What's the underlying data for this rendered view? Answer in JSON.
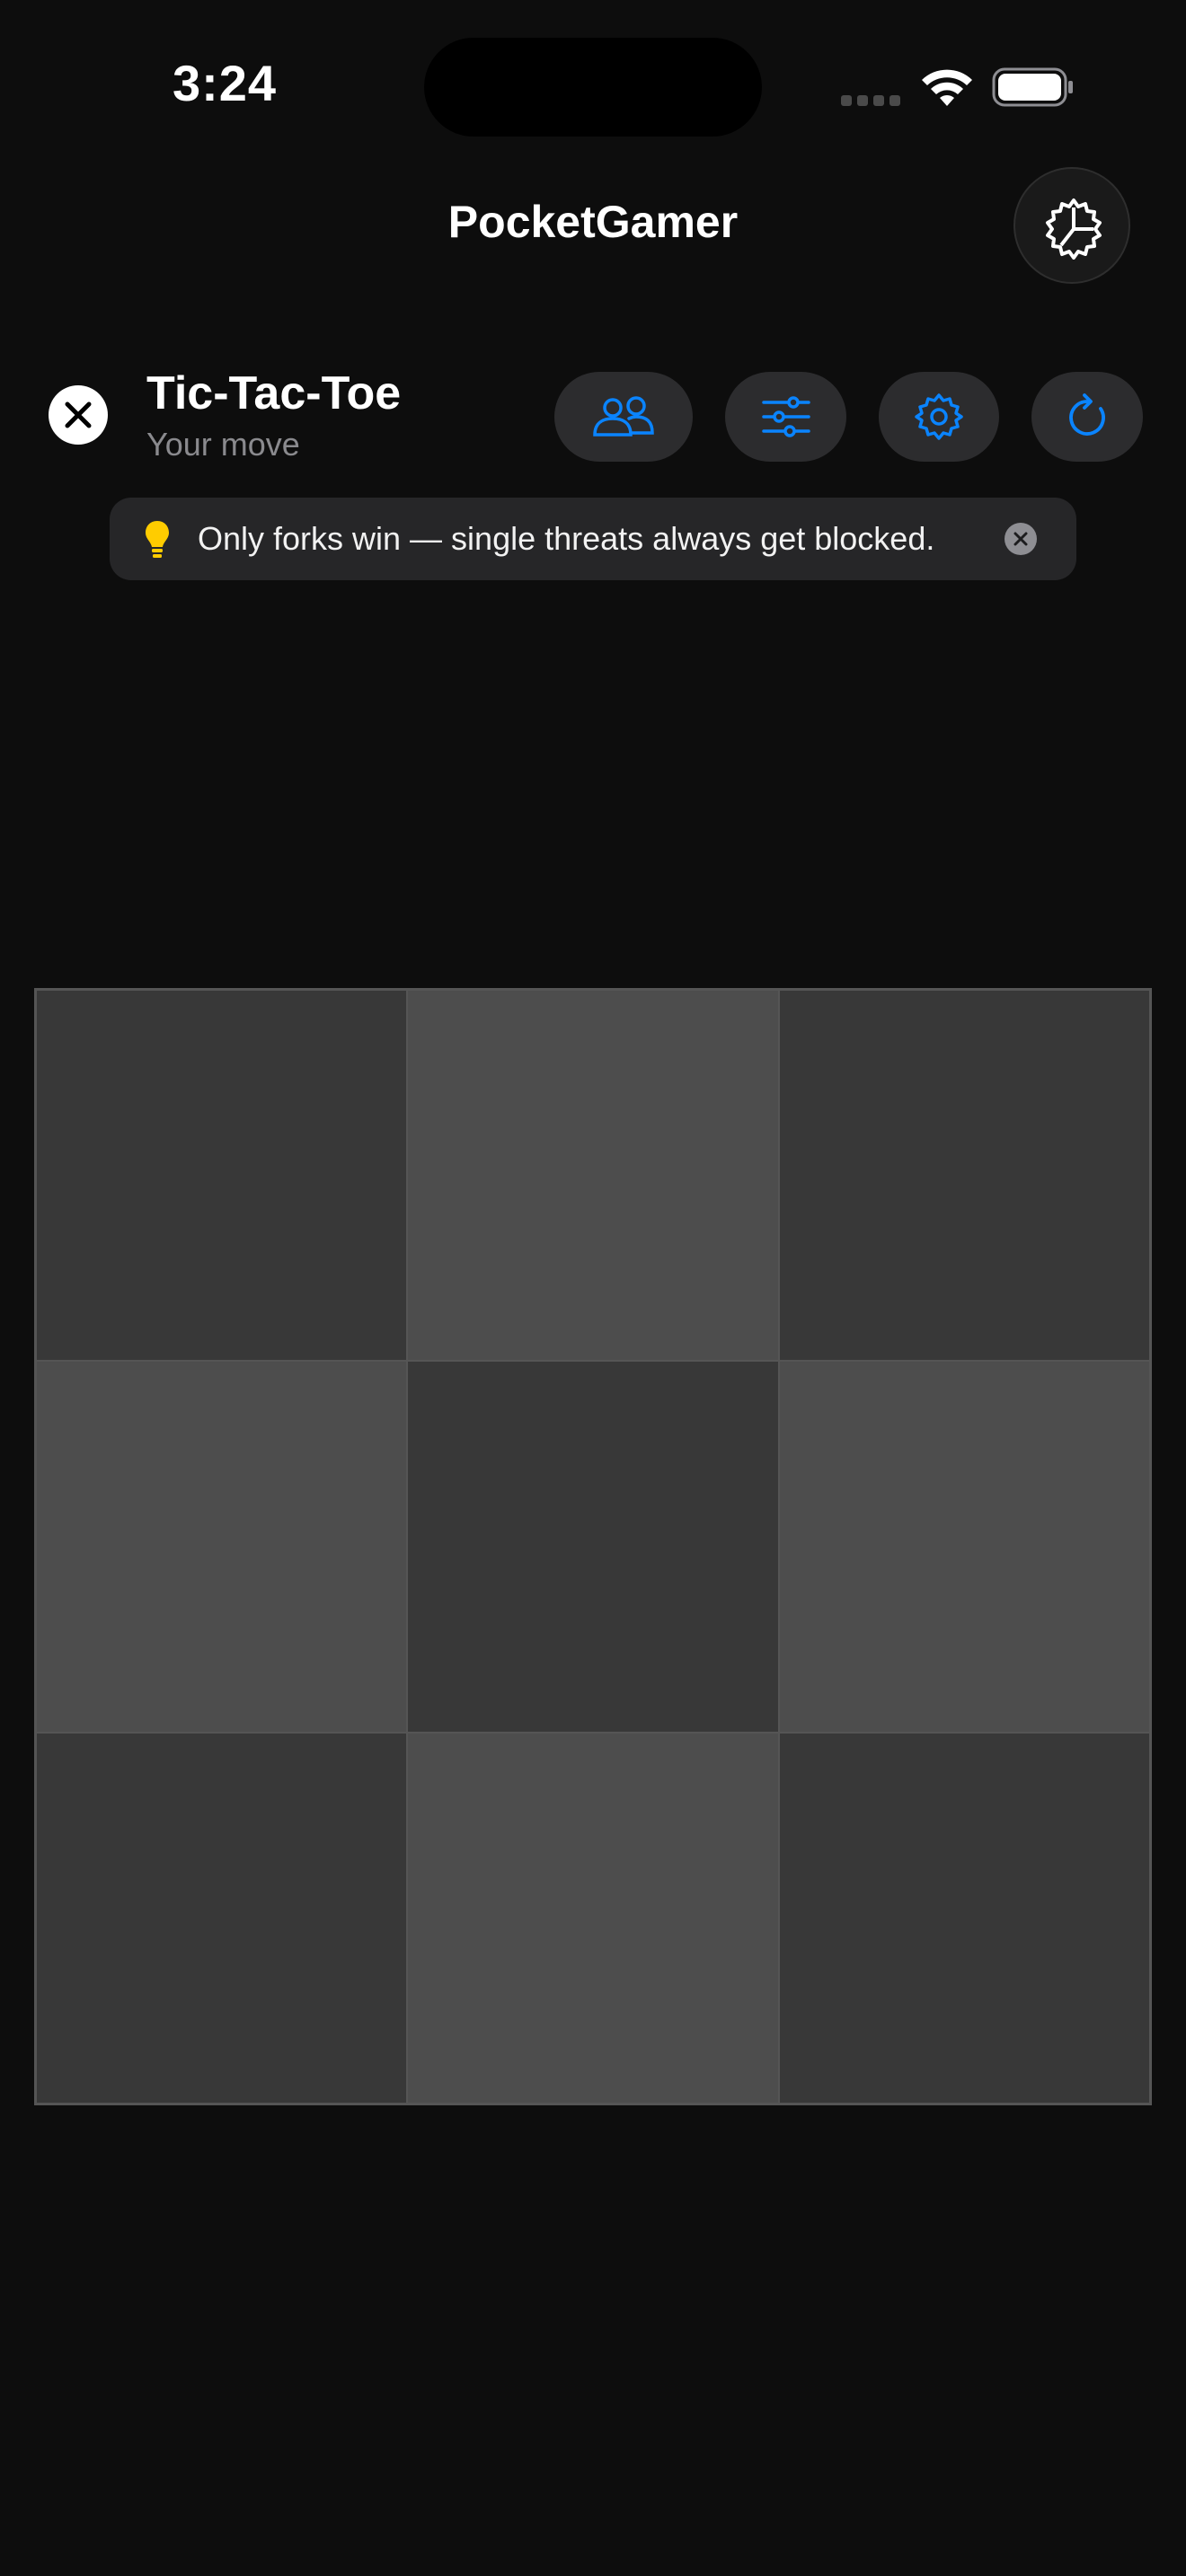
{
  "status_bar": {
    "time": "3:24"
  },
  "nav": {
    "title": "PocketGamer"
  },
  "game": {
    "title": "Tic-Tac-Toe",
    "subtitle": "Your move"
  },
  "toolbar": {
    "icons": [
      "close-icon",
      "players-icon",
      "sliders-icon",
      "gear-icon",
      "restart-icon"
    ]
  },
  "hint": {
    "text": "Only forks win — single threats always get blocked."
  },
  "board": {
    "cells": [
      "",
      "",
      "",
      "",
      "",
      "",
      "",
      "",
      ""
    ]
  },
  "colors": {
    "background": "#0d0d0d",
    "accent": "#0a84ff",
    "button_bg": "#2c2c2e",
    "hint_icon": "#ffcc00",
    "cell_dark": "#383838",
    "cell_light": "#4d4d4d"
  }
}
